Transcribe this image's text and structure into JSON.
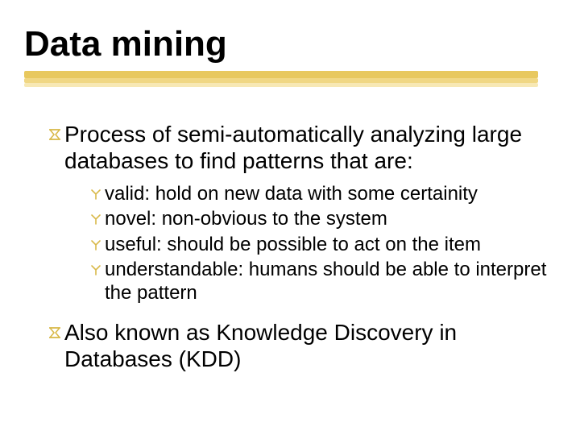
{
  "title": "Data mining",
  "bullets": [
    {
      "text": "Process of semi-automatically analyzing large databases to find patterns that are:",
      "children": [
        {
          "text": "valid:  hold on new data with some certainity"
        },
        {
          "text": "novel:  non-obvious to the system"
        },
        {
          "text": "useful:  should be possible to act on the item"
        },
        {
          "text": "understandable: humans should be able to interpret the pattern"
        }
      ]
    },
    {
      "text": "Also known as Knowledge Discovery in Databases (KDD)",
      "children": []
    }
  ]
}
